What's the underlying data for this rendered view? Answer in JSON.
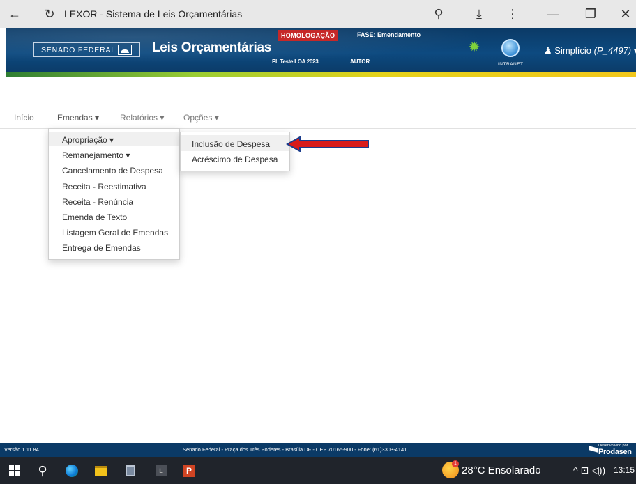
{
  "browser": {
    "title": "LEXOR - Sistema de Leis Orçamentárias",
    "icons": {
      "back": "arrow-left-icon",
      "reload": "reload-icon",
      "zoom": "zoom-out-icon",
      "download": "download-icon",
      "menu": "kebab-menu-icon",
      "minimize": "minimize-icon",
      "restore": "restore-icon",
      "close": "close-icon"
    },
    "glyphs": {
      "back": "←",
      "reload": "↻",
      "zoom": "⚲",
      "download": "⤓",
      "menu": "⋮",
      "minimize": "—",
      "restore": "❐",
      "close": "✕"
    }
  },
  "header": {
    "logo_text": "SENADO FEDERAL",
    "app_title": "Leis Orçamentárias",
    "homologacao": "HOMOLOGAÇÃO",
    "fase": "FASE: Emendamento",
    "pl": "PL Teste LOA 2023",
    "autor": "AUTOR",
    "intranet": "INTRANET",
    "user_icon": "user-icon",
    "user_name": "Simplício",
    "user_id": "(P_4497)",
    "user_caret": "▾",
    "colors": {
      "header_bg": "#0b3a66",
      "badge": "#c62828"
    }
  },
  "nav": {
    "inicio": "Início",
    "emendas": "Emendas ▾",
    "relatorios": "Relatórios ▾",
    "opcoes": "Opções ▾"
  },
  "emendas_menu": {
    "items": [
      "Apropriação ▾",
      "Remanejamento ▾",
      "Cancelamento de Despesa",
      "Receita - Reestimativa",
      "Receita - Renúncia",
      "Emenda de Texto",
      "Listagem Geral de Emendas",
      "Entrega de Emendas"
    ]
  },
  "apropriacao_submenu": {
    "items": [
      "Inclusão de Despesa",
      "Acréscimo de Despesa"
    ]
  },
  "annotation": {
    "arrow_color": "#d81b1b",
    "arrow_icon": "red-arrow-icon"
  },
  "footer": {
    "version": "Versão 1.11.84",
    "address": "Senado Federal - Praça dos Três Poderes - Brasília DF - CEP 70165-900 - Fone: (61)3303-4141",
    "dev_small": "Desenvolvido por",
    "dev_brand": "Prodasen"
  },
  "taskbar": {
    "weather": "28°C  Ensolarado",
    "weather_badge": "1",
    "sys_icons": "^  ⊡ ◁))",
    "time": "13:15"
  }
}
